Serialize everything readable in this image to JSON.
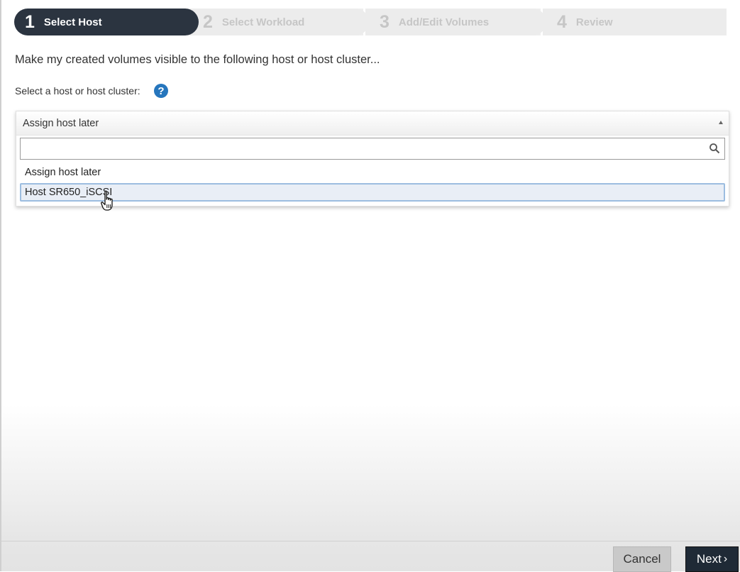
{
  "wizard": {
    "steps": [
      {
        "number": "1",
        "label": "Select Host"
      },
      {
        "number": "2",
        "label": "Select Workload"
      },
      {
        "number": "3",
        "label": "Add/Edit Volumes"
      },
      {
        "number": "4",
        "label": "Review"
      }
    ],
    "active_step": 1
  },
  "main": {
    "intro_text": "Make my created volumes visible to the following host or host cluster...",
    "select_label": "Select a host or host cluster:",
    "help_icon": "help-circle-icon"
  },
  "host_dropdown": {
    "selected_value": "Assign host later",
    "search_value": "",
    "search_placeholder": "",
    "options": [
      "Assign host later",
      "Host SR650_iSCSI"
    ],
    "highlighted_option": "Host SR650_iSCSI"
  },
  "footer": {
    "cancel_label": "Cancel",
    "next_label": "Next",
    "next_icon": "chevron-right-icon"
  },
  "colors": {
    "active_step_bg": "#2b3440",
    "help_icon": "#2676bd",
    "next_button_bg": "#1f2a36",
    "highlight_border": "#9cbde0"
  }
}
